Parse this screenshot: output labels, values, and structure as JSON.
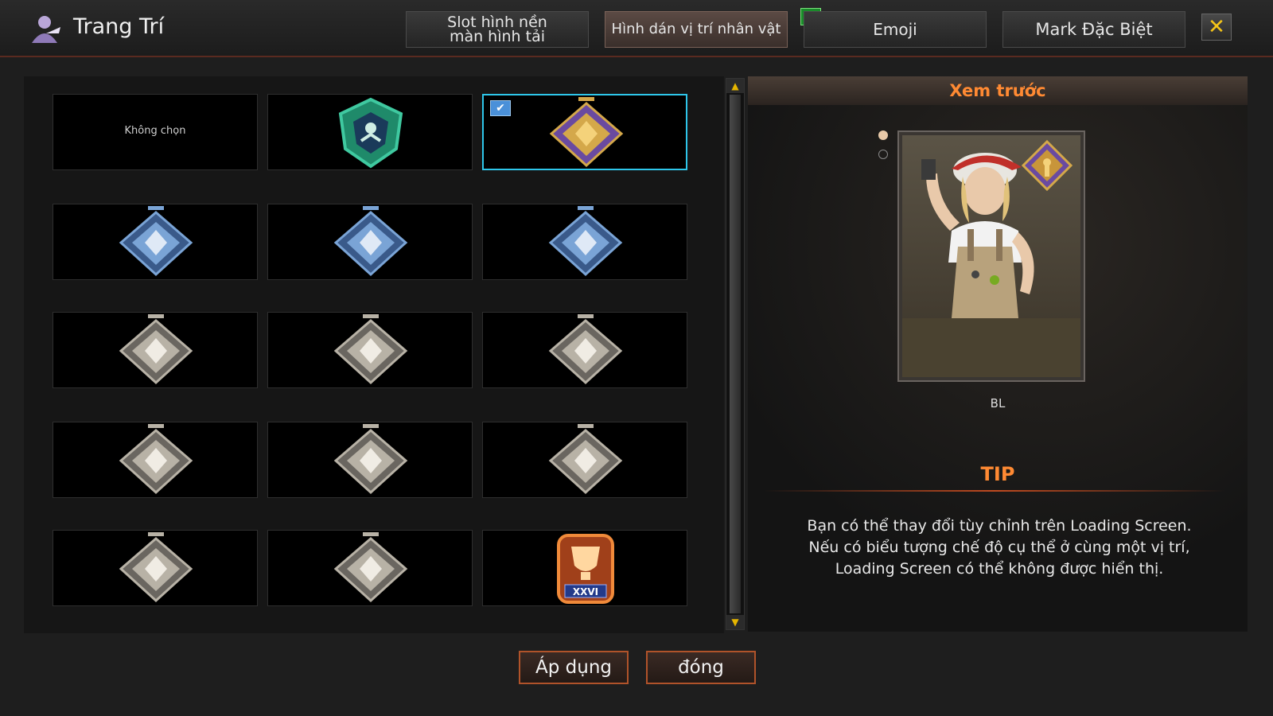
{
  "header": {
    "title": "Trang Trí",
    "tabs": [
      {
        "label": "Slot hình nền\nmàn hình tải",
        "active": false
      },
      {
        "label": "Hình dán vị trí nhân vật",
        "active": true
      },
      {
        "label": "Emoji",
        "active": false
      },
      {
        "label": "Mark Đặc Biệt",
        "active": false
      }
    ],
    "new_badge": "N",
    "close_label": "✕"
  },
  "grid": {
    "empty_label": "Không chọn",
    "selected_index": 2,
    "slots": [
      {
        "type": "empty"
      },
      {
        "type": "medal",
        "icon": "green-crest-medal-icon"
      },
      {
        "type": "medal",
        "icon": "gold-soldier-medal-icon"
      },
      {
        "type": "medal",
        "icon": "blue-tank-medal-icon"
      },
      {
        "type": "medal",
        "icon": "blue-compass-medal-icon"
      },
      {
        "type": "medal",
        "icon": "blue-eagle-medal-icon"
      },
      {
        "type": "medal",
        "icon": "silver-star-medal-icon"
      },
      {
        "type": "medal",
        "icon": "silver-crossed-rifles-medal-icon"
      },
      {
        "type": "medal",
        "icon": "silver-trophy-medal-icon"
      },
      {
        "type": "medal",
        "icon": "silver-arrow-medal-icon"
      },
      {
        "type": "medal",
        "icon": "silver-cup-medal-icon"
      },
      {
        "type": "medal",
        "icon": "silver-crosshair-grenade-medal-icon"
      },
      {
        "type": "medal",
        "icon": "silver-star-plus-medal-icon"
      },
      {
        "type": "medal",
        "icon": "silver-skull-medal-icon"
      },
      {
        "type": "medal",
        "icon": "orange-trophy-xxvi-medal-icon"
      }
    ],
    "trophy_label": "XXVI"
  },
  "preview": {
    "title": "Xem trước",
    "character_name": "BL",
    "tip_title": "TIP",
    "tip_text": "Bạn có thể thay đổi tùy chỉnh trên Loading Screen.\nNếu có biểu tượng chế độ cụ thể ở cùng một vị trí,\nLoading Screen có thể không được hiển thị."
  },
  "buttons": {
    "apply": "Áp dụng",
    "close": "đóng"
  },
  "colors": {
    "accent_orange": "#ff8a33",
    "selection_cyan": "#2ec6ea"
  }
}
